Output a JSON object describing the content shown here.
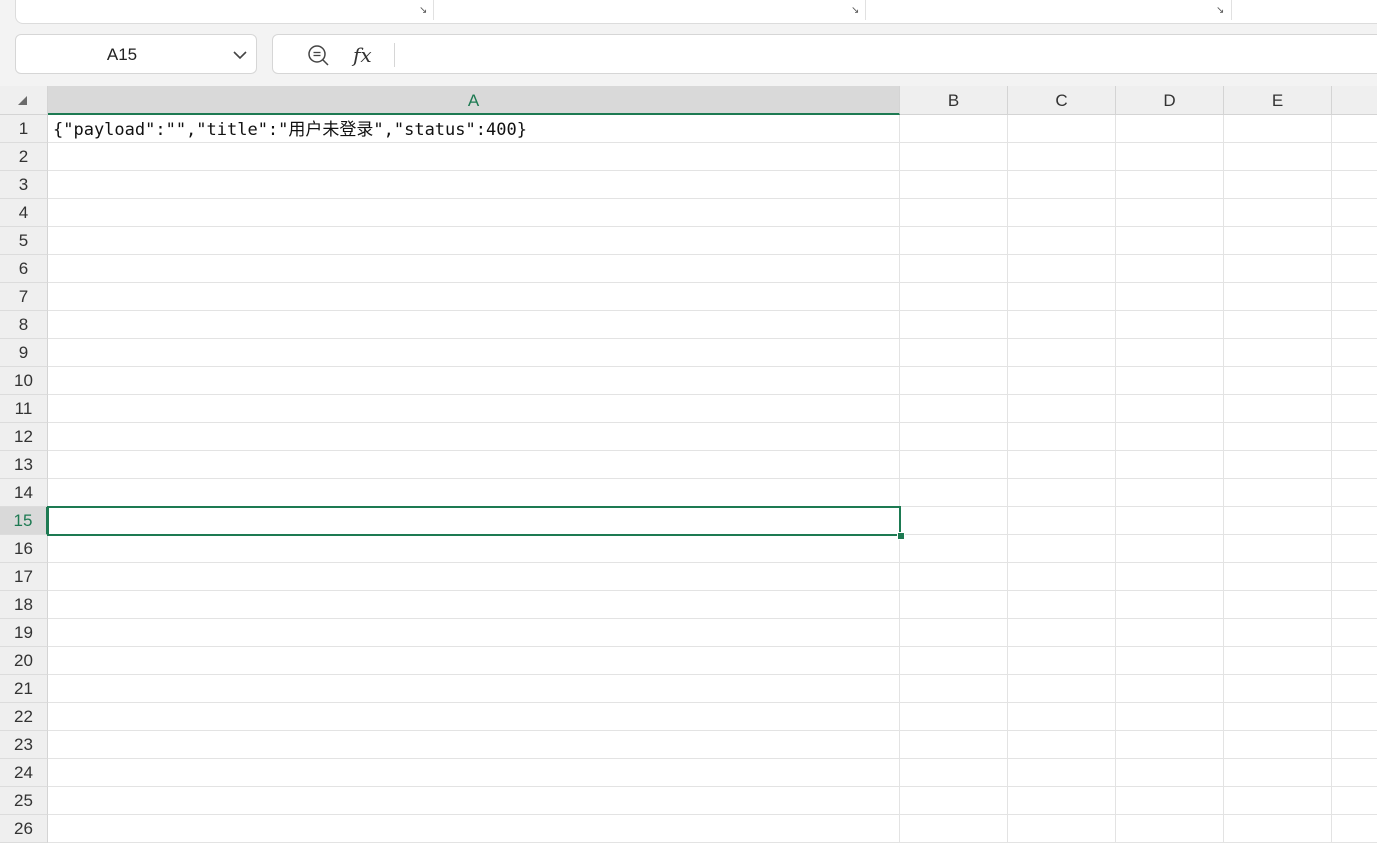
{
  "ribbon": {
    "launchers": [
      "dialog-launcher",
      "dialog-launcher",
      "dialog-launcher"
    ]
  },
  "name_box": {
    "value": "A15"
  },
  "formula_bar": {
    "fx_label": "fx",
    "value": ""
  },
  "sheet": {
    "corner_icon": "select-all-triangle",
    "columns": [
      "A",
      "B",
      "C",
      "D",
      "E"
    ],
    "rows": [
      "1",
      "2",
      "3",
      "4",
      "5",
      "6",
      "7",
      "8",
      "9",
      "10",
      "11",
      "12",
      "13",
      "14",
      "15",
      "16",
      "17",
      "18",
      "19",
      "20",
      "21",
      "22",
      "23",
      "24",
      "25",
      "26"
    ],
    "active_column": "A",
    "active_row": "15",
    "cells": {
      "A1": "{\"payload\":\"\",\"title\":\"用户未登录\",\"status\":400}"
    }
  },
  "colors": {
    "accent": "#1d7a52"
  }
}
